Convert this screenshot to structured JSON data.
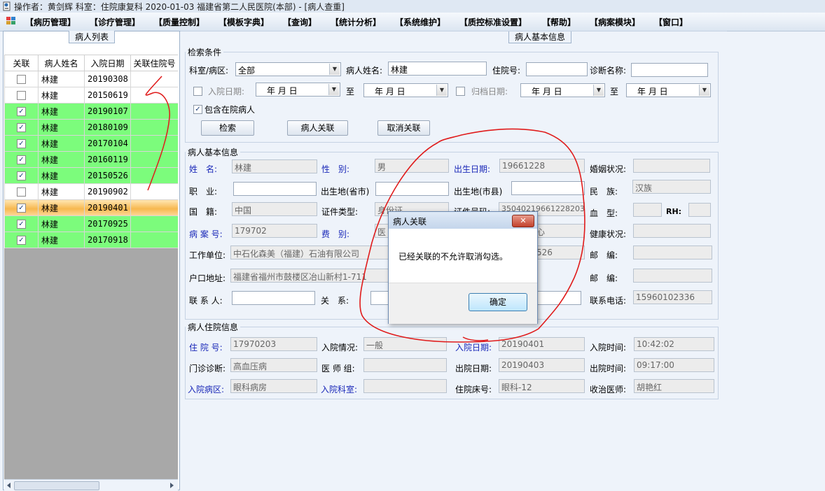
{
  "window": {
    "title": "操作者：黄剑辉  科室：住院康复科  2020-01-03  福建省第二人民医院(本部) - [病人查重]"
  },
  "menu": [
    "【病历管理】",
    "【诊疗管理】",
    "【质量控制】",
    "【模板字典】",
    "【查询】",
    "【统计分析】",
    "【系统维护】",
    "【质控标准设置】",
    "【帮助】",
    "【病案模块】",
    "【窗口】"
  ],
  "left_panel": {
    "title": "病人列表",
    "columns": [
      "关联",
      "病人姓名",
      "入院日期",
      "关联住院号"
    ],
    "rows": [
      {
        "checked": false,
        "name": "林建",
        "date": "20190308",
        "linked_id": "",
        "style": "white"
      },
      {
        "checked": false,
        "name": "林建",
        "date": "20150619",
        "linked_id": "",
        "style": "white"
      },
      {
        "checked": true,
        "name": "林建",
        "date": "20190107",
        "linked_id": "",
        "style": "green"
      },
      {
        "checked": true,
        "name": "林建",
        "date": "20180109",
        "linked_id": "",
        "style": "green"
      },
      {
        "checked": true,
        "name": "林建",
        "date": "20170104",
        "linked_id": "",
        "style": "green"
      },
      {
        "checked": true,
        "name": "林建",
        "date": "20160119",
        "linked_id": "",
        "style": "green"
      },
      {
        "checked": true,
        "name": "林建",
        "date": "20150526",
        "linked_id": "",
        "style": "green"
      },
      {
        "checked": false,
        "name": "林建",
        "date": "20190902",
        "linked_id": "",
        "style": "white"
      },
      {
        "checked": true,
        "name": "林建",
        "date": "20190401",
        "linked_id": "",
        "style": "sel"
      },
      {
        "checked": true,
        "name": "林建",
        "date": "20170925",
        "linked_id": "",
        "style": "green"
      },
      {
        "checked": true,
        "name": "林建",
        "date": "20170918",
        "linked_id": "",
        "style": "green"
      }
    ]
  },
  "right_panel": {
    "title": "病人基本信息",
    "search": {
      "legend": "检索条件",
      "dept_label": "科室/病区:",
      "dept_value": "全部",
      "name_label": "病人姓名:",
      "name_value": "林建",
      "inpatient_label": "住院号:",
      "inpatient_value": "",
      "diag_label": "诊断名称:",
      "diag_value": "",
      "admit_date_label": "入院日期:",
      "date_placeholder": "年  月  日",
      "to_label": "至",
      "archive_date_label": "归档日期:",
      "include_label": "包含在院病人",
      "include_checked": true,
      "search_btn": "检索",
      "link_btn": "病人关联",
      "unlink_btn": "取消关联"
    },
    "basic": {
      "legend": "病人基本信息",
      "labels": {
        "name": "姓　名:",
        "sex": "性　别:",
        "birth": "出生日期:",
        "marital": "婚姻状况:",
        "job": "职　业:",
        "birth_prov": "出生地(省市)",
        "birth_city": "出生地(市县)",
        "ethnic": "民　族:",
        "nation": "国　籍:",
        "id_type": "证件类型:",
        "id_no": "证件号码:",
        "blood": "血　型:",
        "rh": "RH:",
        "case_no": "病 案 号:",
        "fee": "费　别:",
        "health": "健康状况:",
        "work": "工作单位:",
        "post1": "邮　编:",
        "home": "户口地址:",
        "post2": "邮　编:",
        "contact": "联 系 人:",
        "relation": "关　系:",
        "phone": "联系电话:"
      },
      "values": {
        "name": "林建",
        "sex": "男",
        "birth": "19661228",
        "marital": "",
        "job": "",
        "birth_prov": "",
        "birth_city": "",
        "ethnic": "汉族",
        "nation": "中国",
        "id_type": "身份证",
        "id_no": "35040219661228203X",
        "blood": "",
        "rh": "",
        "case_no": "179702",
        "fee": "医",
        "fee_extra": "心",
        "health": "",
        "work": "中石化森美（福建）石油有限公司",
        "work_extra": "526",
        "post1": "",
        "home": "福建省福州市鼓楼区冶山新村1-711",
        "post2": "",
        "contact": "",
        "relation": "",
        "phone": "15960102336"
      }
    },
    "stay": {
      "legend": "病人住院信息",
      "labels": {
        "inpatient_no": "住 院 号:",
        "admit_status": "入院情况:",
        "admit_date": "入院日期:",
        "admit_time": "入院时间:",
        "outpatient_diag": "门诊诊断:",
        "doctor_group": "医 师 组:",
        "discharge_date": "出院日期:",
        "discharge_time": "出院时间:",
        "ward": "入院病区:",
        "dept": "入院科室:",
        "bed": "住院床号:",
        "doctor": "收治医师:"
      },
      "values": {
        "inpatient_no": "17970203",
        "admit_status": "一般",
        "admit_date": "20190401",
        "admit_time": "10:42:02",
        "outpatient_diag": "高血压病",
        "doctor_group": "",
        "discharge_date": "20190403",
        "discharge_time": "09:17:00",
        "ward": "眼科病房",
        "dept": "",
        "bed": "眼科-12",
        "doctor": "胡艳红"
      }
    }
  },
  "dialog": {
    "title": "病人关联",
    "message": "已经关联的不允许取消勾选。",
    "ok": "确定",
    "close": "✕"
  },
  "colors": {
    "linked_row": "#7cfc7c",
    "selected_row": "#f7b84f",
    "annotation": "#e01b1b",
    "label_blue": "#1a28b8"
  }
}
